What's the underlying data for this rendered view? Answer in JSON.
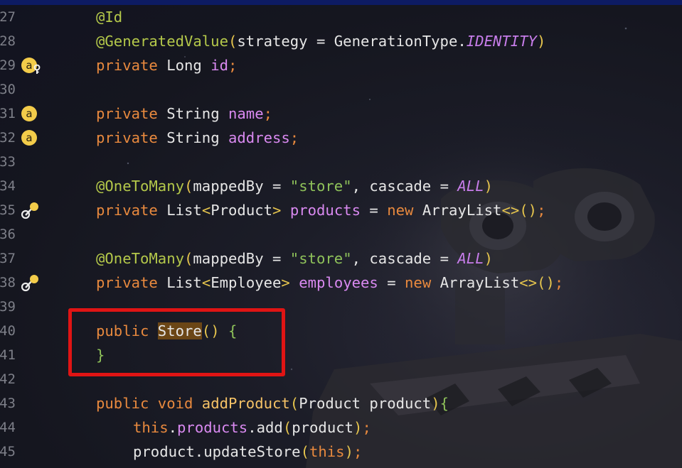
{
  "lines": [
    {
      "num": "27",
      "tokens": [
        {
          "t": "@Id",
          "c": "ann"
        }
      ]
    },
    {
      "num": "28",
      "tokens": [
        {
          "t": "@GeneratedValue",
          "c": "ann"
        },
        {
          "t": "(",
          "c": "par-y"
        },
        {
          "t": "strategy = GenerationType.",
          "c": "pl"
        },
        {
          "t": "IDENTITY",
          "c": "con"
        },
        {
          "t": ")",
          "c": "par-y"
        }
      ]
    },
    {
      "num": "29",
      "gutter_icon": "field-key-icon",
      "tokens": [
        {
          "t": "private ",
          "c": "kw"
        },
        {
          "t": "Long ",
          "c": "pl"
        },
        {
          "t": "id",
          "c": "fld"
        },
        {
          "t": ";",
          "c": "kw"
        }
      ]
    },
    {
      "num": "30",
      "tokens": []
    },
    {
      "num": "31",
      "gutter_icon": "field-icon",
      "tokens": [
        {
          "t": "private ",
          "c": "kw"
        },
        {
          "t": "String ",
          "c": "pl"
        },
        {
          "t": "name",
          "c": "fld"
        },
        {
          "t": ";",
          "c": "kw"
        }
      ]
    },
    {
      "num": "32",
      "gutter_icon": "field-icon",
      "tokens": [
        {
          "t": "private ",
          "c": "kw"
        },
        {
          "t": "String ",
          "c": "pl"
        },
        {
          "t": "address",
          "c": "fld"
        },
        {
          "t": ";",
          "c": "kw"
        }
      ]
    },
    {
      "num": "33",
      "tokens": []
    },
    {
      "num": "34",
      "tokens": [
        {
          "t": "@OneToMany",
          "c": "ann"
        },
        {
          "t": "(",
          "c": "par-y"
        },
        {
          "t": "mappedBy = ",
          "c": "pl"
        },
        {
          "t": "\"store\"",
          "c": "str"
        },
        {
          "t": ", cascade = ",
          "c": "pl"
        },
        {
          "t": "ALL",
          "c": "con"
        },
        {
          "t": ")",
          "c": "par-y"
        }
      ]
    },
    {
      "num": "35",
      "gutter_icon": "relation-link-icon",
      "tokens": [
        {
          "t": "private ",
          "c": "kw"
        },
        {
          "t": "List",
          "c": "pl"
        },
        {
          "t": "<",
          "c": "par-y"
        },
        {
          "t": "Product",
          "c": "pl"
        },
        {
          "t": "> ",
          "c": "par-y"
        },
        {
          "t": "products",
          "c": "fld"
        },
        {
          "t": " = ",
          "c": "pl"
        },
        {
          "t": "new ",
          "c": "kw"
        },
        {
          "t": "ArrayList",
          "c": "pl"
        },
        {
          "t": "<>",
          "c": "par-y"
        },
        {
          "t": "()",
          "c": "par-y"
        },
        {
          "t": ";",
          "c": "kw"
        }
      ]
    },
    {
      "num": "36",
      "tokens": []
    },
    {
      "num": "37",
      "tokens": [
        {
          "t": "@OneToMany",
          "c": "ann"
        },
        {
          "t": "(",
          "c": "par-y"
        },
        {
          "t": "mappedBy = ",
          "c": "pl"
        },
        {
          "t": "\"store\"",
          "c": "str"
        },
        {
          "t": ", cascade = ",
          "c": "pl"
        },
        {
          "t": "ALL",
          "c": "con"
        },
        {
          "t": ")",
          "c": "par-y"
        }
      ]
    },
    {
      "num": "38",
      "gutter_icon": "relation-link-icon",
      "tokens": [
        {
          "t": "private ",
          "c": "kw"
        },
        {
          "t": "List",
          "c": "pl"
        },
        {
          "t": "<",
          "c": "par-y"
        },
        {
          "t": "Employee",
          "c": "pl"
        },
        {
          "t": "> ",
          "c": "par-y"
        },
        {
          "t": "employees",
          "c": "fld"
        },
        {
          "t": " = ",
          "c": "pl"
        },
        {
          "t": "new ",
          "c": "kw"
        },
        {
          "t": "ArrayList",
          "c": "pl"
        },
        {
          "t": "<>",
          "c": "par-y"
        },
        {
          "t": "()",
          "c": "par-y"
        },
        {
          "t": ";",
          "c": "kw"
        }
      ]
    },
    {
      "num": "39",
      "tokens": []
    },
    {
      "num": "40",
      "tokens": [
        {
          "t": "public ",
          "c": "kw"
        },
        {
          "t": "Store",
          "c": "pl hl"
        },
        {
          "t": "() ",
          "c": "par-y"
        },
        {
          "t": "{",
          "c": "br"
        }
      ]
    },
    {
      "num": "41",
      "tokens": [
        {
          "t": "}",
          "c": "br"
        }
      ]
    },
    {
      "num": "42",
      "tokens": []
    },
    {
      "num": "43",
      "tokens": [
        {
          "t": "public ",
          "c": "kw"
        },
        {
          "t": "void ",
          "c": "kw"
        },
        {
          "t": "addProduct",
          "c": "meth"
        },
        {
          "t": "(",
          "c": "par-y"
        },
        {
          "t": "Product product",
          "c": "pl"
        },
        {
          "t": ")",
          "c": "par-y"
        },
        {
          "t": "{",
          "c": "br"
        }
      ]
    },
    {
      "num": "44",
      "indent": 2,
      "tokens": [
        {
          "t": "this",
          "c": "kw"
        },
        {
          "t": ".",
          "c": "pl"
        },
        {
          "t": "products",
          "c": "fld"
        },
        {
          "t": ".add",
          "c": "pl"
        },
        {
          "t": "(",
          "c": "par-y"
        },
        {
          "t": "product",
          "c": "pl"
        },
        {
          "t": ")",
          "c": "par-y"
        },
        {
          "t": ";",
          "c": "kw"
        }
      ]
    },
    {
      "num": "45",
      "indent": 2,
      "tokens": [
        {
          "t": "product.updateStore",
          "c": "pl"
        },
        {
          "t": "(",
          "c": "par-y"
        },
        {
          "t": "this",
          "c": "kw"
        },
        {
          "t": ")",
          "c": "par-y"
        },
        {
          "t": ";",
          "c": "kw"
        }
      ]
    }
  ],
  "annotation": {
    "shape": "highlight-rectangle",
    "color": "#e01414",
    "target_lines": [
      "40",
      "41"
    ]
  },
  "colors": {
    "background": "#1a1b26",
    "annotation": "#ae9f44",
    "keyword": "#e8893e",
    "field": "#d989f0",
    "string": "#8fc25a",
    "method": "#f5c266",
    "identifier_highlight": "#6b4616",
    "highlight_box": "#e01414"
  }
}
